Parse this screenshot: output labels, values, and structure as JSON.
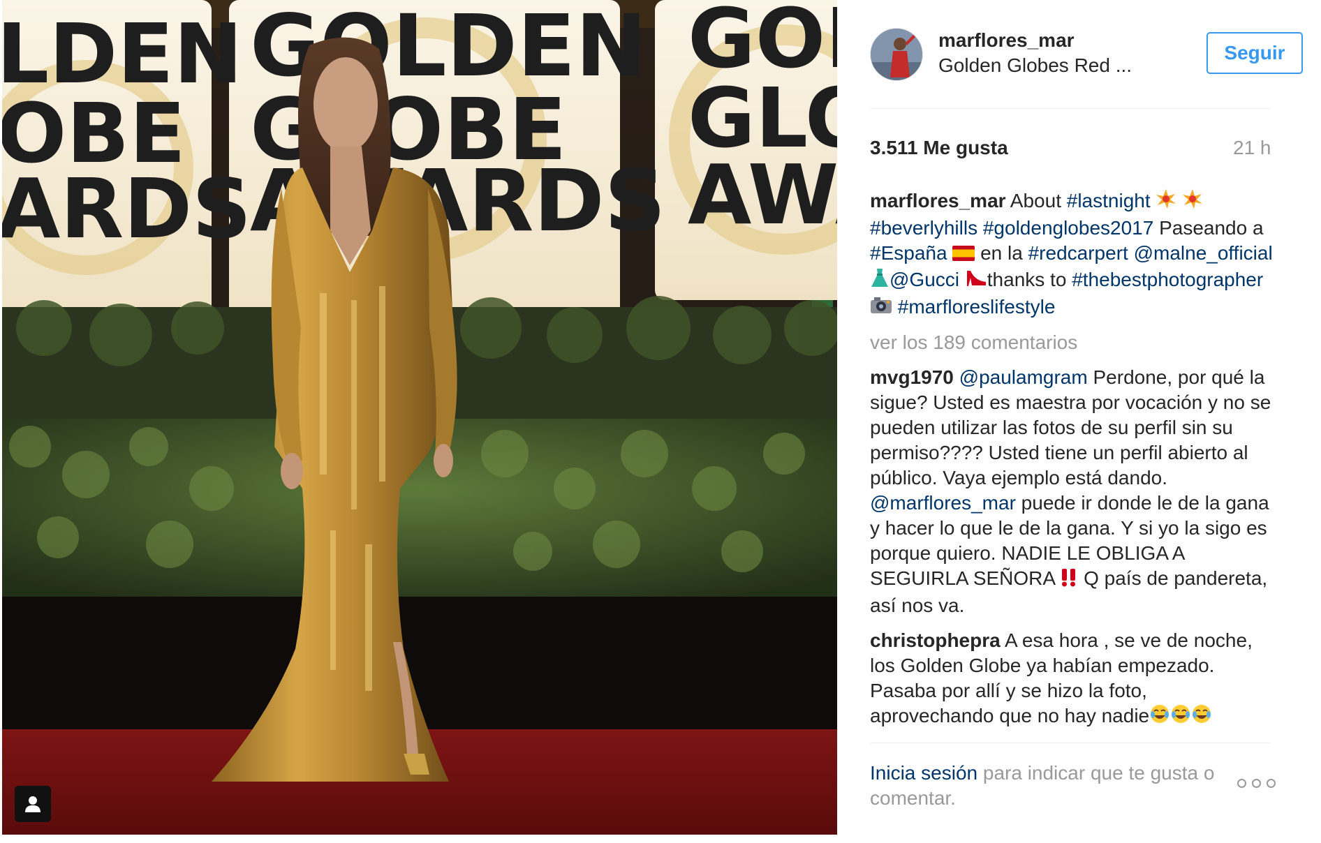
{
  "post": {
    "username": "marflores_mar",
    "location": "Golden Globes Red ...",
    "follow_label": "Seguir",
    "likes": "3.511 Me gusta",
    "time": "21 h"
  },
  "photo_signage": {
    "left_board": [
      "LDEN",
      "OBE",
      "ARDS"
    ],
    "center_board": [
      "GOLDEN",
      "GLOBE",
      "AWARDS"
    ],
    "right_board": [
      "GOL",
      "GLO",
      "AWA"
    ]
  },
  "caption": {
    "username": "marflores_mar",
    "t1": " About ",
    "h1": "#lastnight",
    "h2": "#beverlyhills",
    "h3": "#goldenglobes2017",
    "t2": " Paseando a ",
    "h4": "#España",
    "t3": " en la ",
    "h5": "#redcarpert",
    "m1": "@malne_official",
    "m2": "@Gucci",
    "t4": "thanks to",
    "h6": "#thebestphotographer",
    "h7": "#marfloreslifestyle"
  },
  "view_comments": "ver los 189 comentarios",
  "comments": [
    {
      "username": "mvg1970",
      "mention": "@paulamgram",
      "text1": " Perdone, por qué la sigue? Usted es maestra por vocación y no se pueden utilizar las fotos de su perfil sin su permiso???? Usted tiene un perfil abierto al público. Vaya ejemplo está dando. ",
      "mention2": "@marflores_mar",
      "text2": " puede ir donde le de la gana y hacer lo que le de la gana. Y si yo la sigo es porque quiero. NADIE LE OBLIGA A SEGUIRLA SEÑORA ",
      "text3": " Q país de pandereta, así nos va."
    },
    {
      "username": "christophepra",
      "text": " A esa hora , se ve de noche, los Golden Globe ya habían empezado. Pasaba por allí y se hizo la foto, aprovechando que no hay nadie"
    }
  ],
  "login": {
    "link": "Inicia sesión",
    "text": " para indicar que te gusta o comentar."
  },
  "icons": [
    "user-tag-icon",
    "collision-emoji",
    "spain-flag-emoji",
    "dress-emoji",
    "heel-shoe-emoji",
    "camera-emoji",
    "double-exclamation-emoji",
    "tears-of-joy-emoji",
    "more-options-icon"
  ],
  "colors": {
    "link": "#003569",
    "follow": "#3897f0",
    "muted": "#999999",
    "text": "#262626"
  }
}
